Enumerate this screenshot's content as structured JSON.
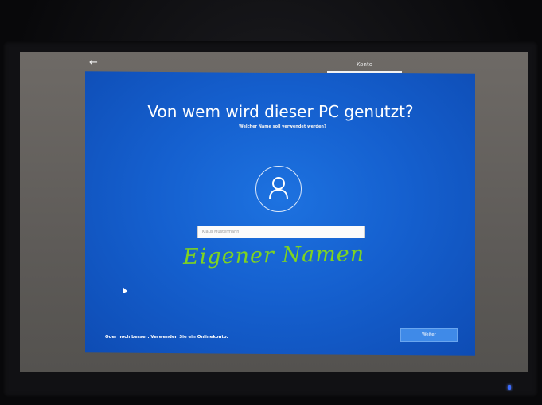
{
  "header": {
    "back_icon": "back-arrow-icon",
    "tab_label": "Konto"
  },
  "main": {
    "title": "Von wem wird dieser PC genutzt?",
    "subtitle": "Welcher Name soll verwendet werden?",
    "avatar_icon": "user-icon",
    "name_input": {
      "placeholder": "Klaus Mustermann",
      "value": ""
    },
    "handwritten_annotation": "Eigener Namen"
  },
  "footer": {
    "online_account_link": "Oder noch besser: Verwenden Sie ein Onlinekonto.",
    "next_button": "Weiter"
  },
  "colors": {
    "panel_blue": "#1560cf",
    "button_blue": "#3f8ae8",
    "annotation_green": "#7ed321"
  }
}
